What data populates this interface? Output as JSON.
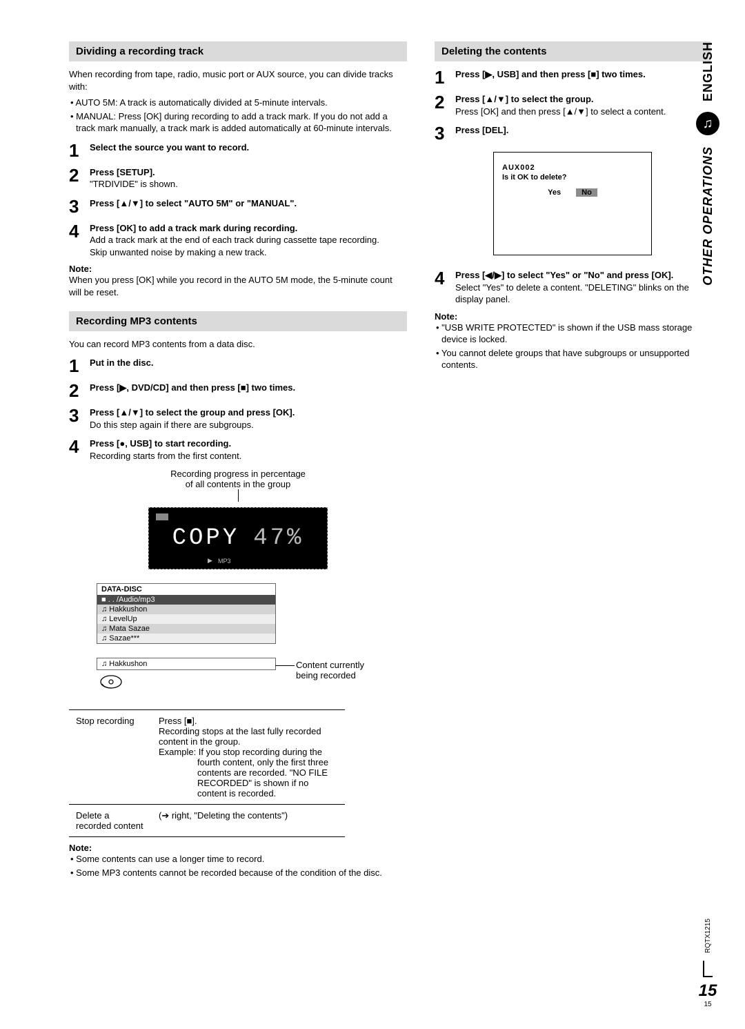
{
  "side": {
    "lang": "ENGLISH",
    "section": "OTHER OPERATIONS",
    "doc_code": "RQTX1215",
    "page_big": "15",
    "page_small": "15"
  },
  "left": {
    "div_head": "Dividing a recording track",
    "div_intro": "When recording from tape, radio, music port or AUX source, you can divide tracks with:",
    "div_b1": "• AUTO 5M: A track is automatically divided at 5-minute intervals.",
    "div_b2": "• MANUAL: Press [OK] during recording to add a track mark. If you do not add a track mark manually, a track mark is added automatically at 60-minute intervals.",
    "s1": "Select the source you want to record.",
    "s2": "Press [SETUP].",
    "s2_sub": "\"TRDIVIDE\" is shown.",
    "s3": "Press [▲/▼] to select \"AUTO 5M\" or \"MANUAL\".",
    "s4": "Press [OK] to add a track mark during recording.",
    "s4_sub1": "Add a track mark at the end of each track during cassette tape recording.",
    "s4_sub2": "Skip unwanted noise by making a new track.",
    "note_h": "Note:",
    "note_body": "When you press [OK] while you record in the AUTO 5M mode, the 5-minute count will be reset.",
    "mp3_head": "Recording MP3 contents",
    "mp3_intro": "You can record MP3 contents from a data disc.",
    "m1": "Put in the disc.",
    "m2": "Press [▶, DVD/CD] and then press [■] two times.",
    "m3": "Press [▲/▼] to select the group and press [OK].",
    "m3_sub": "Do this step again if there are subgroups.",
    "m4": "Press [●, USB] to start recording.",
    "m4_sub": "Recording starts from the first content.",
    "caption1": "Recording progress in percentage",
    "caption2": "of all contents in the group",
    "lcd_text": "COPY",
    "lcd_val": "47%",
    "lcd_mp3": "MP3",
    "tl_head": "DATA-DISC",
    "tl_r1": "■ . . /Audio/mp3",
    "tl_r2": "♫ Hakkushon",
    "tl_r3": "♫ LevelUp",
    "tl_r4": "♫ Mata Sazae",
    "tl_r5": "♫ Sazae***",
    "tl_cur": "♫ Hakkushon",
    "tl_cur_label1": "Content currently",
    "tl_cur_label2": "being recorded",
    "table": {
      "r1c1": "Stop recording",
      "r1c2a": "Press [■].",
      "r1c2b": "Recording stops at the last fully recorded content in the group.",
      "r1c2c": "Example: If you stop recording during the",
      "r1c2d": "fourth content, only the first three contents are recorded. \"NO FILE RECORDED\" is shown if no content is recorded.",
      "r2c1": "Delete a recorded content",
      "r2c2": "(➔ right, \"Deleting the contents\")"
    },
    "bnote_h": "Note:",
    "bnote1": "• Some contents can use a longer time to record.",
    "bnote2": "• Some MP3 contents cannot be recorded because of the condition of the disc."
  },
  "right": {
    "del_head": "Deleting the contents",
    "d1": "Press [▶, USB] and then press [■] two times.",
    "d2": "Press [▲/▼] to select the group.",
    "d2_sub": "Press [OK] and then press [▲/▼] to select a content.",
    "d3": "Press [DEL].",
    "dlg_title": "AUX002",
    "dlg_q": "Is it OK to delete?",
    "dlg_yes": "Yes",
    "dlg_no": "No",
    "d4": "Press [◀/▶] to select \"Yes\" or \"No\" and press [OK].",
    "d4_sub": "Select \"Yes\" to delete a content. \"DELETING\" blinks on the display panel.",
    "dnote_h": "Note:",
    "dnote1": "• \"USB WRITE PROTECTED\" is shown if the USB mass storage device is locked.",
    "dnote2": "• You cannot delete groups that have subgroups or unsupported contents."
  }
}
